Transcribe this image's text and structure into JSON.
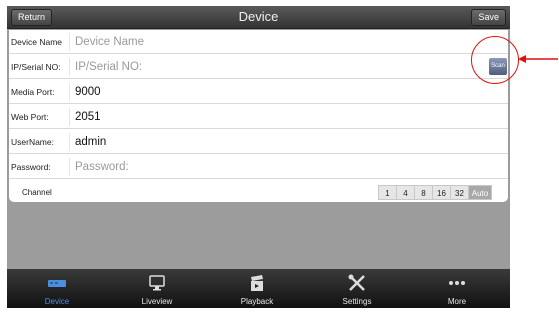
{
  "header": {
    "title": "Device",
    "return_label": "Return",
    "save_label": "Save"
  },
  "form": {
    "fields": [
      {
        "label": "Device Name",
        "value": "",
        "placeholder": "Device Name"
      },
      {
        "label": "IP/Serial NO:",
        "value": "",
        "placeholder": "IP/Serial NO:"
      },
      {
        "label": "Media Port:",
        "value": "9000",
        "placeholder": ""
      },
      {
        "label": "Web Port:",
        "value": "2051",
        "placeholder": ""
      },
      {
        "label": "UserName:",
        "value": "admin",
        "placeholder": ""
      },
      {
        "label": "Password:",
        "value": "",
        "placeholder": "Password:"
      }
    ],
    "scan_label": "Scan",
    "channel_label": "Channel",
    "channel_options": [
      "1",
      "4",
      "8",
      "16",
      "32",
      "Auto"
    ],
    "channel_selected": "Auto"
  },
  "tabbar": {
    "tabs": [
      {
        "label": "Device",
        "icon": "device-icon",
        "active": true
      },
      {
        "label": "Liveview",
        "icon": "monitor-icon",
        "active": false
      },
      {
        "label": "Playback",
        "icon": "clapperboard-icon",
        "active": false
      },
      {
        "label": "Settings",
        "icon": "tools-icon",
        "active": false
      },
      {
        "label": "More",
        "icon": "more-dots-icon",
        "active": false
      }
    ]
  },
  "colors": {
    "active_tab": "#4a8fe0",
    "annotation": "#e01010"
  }
}
